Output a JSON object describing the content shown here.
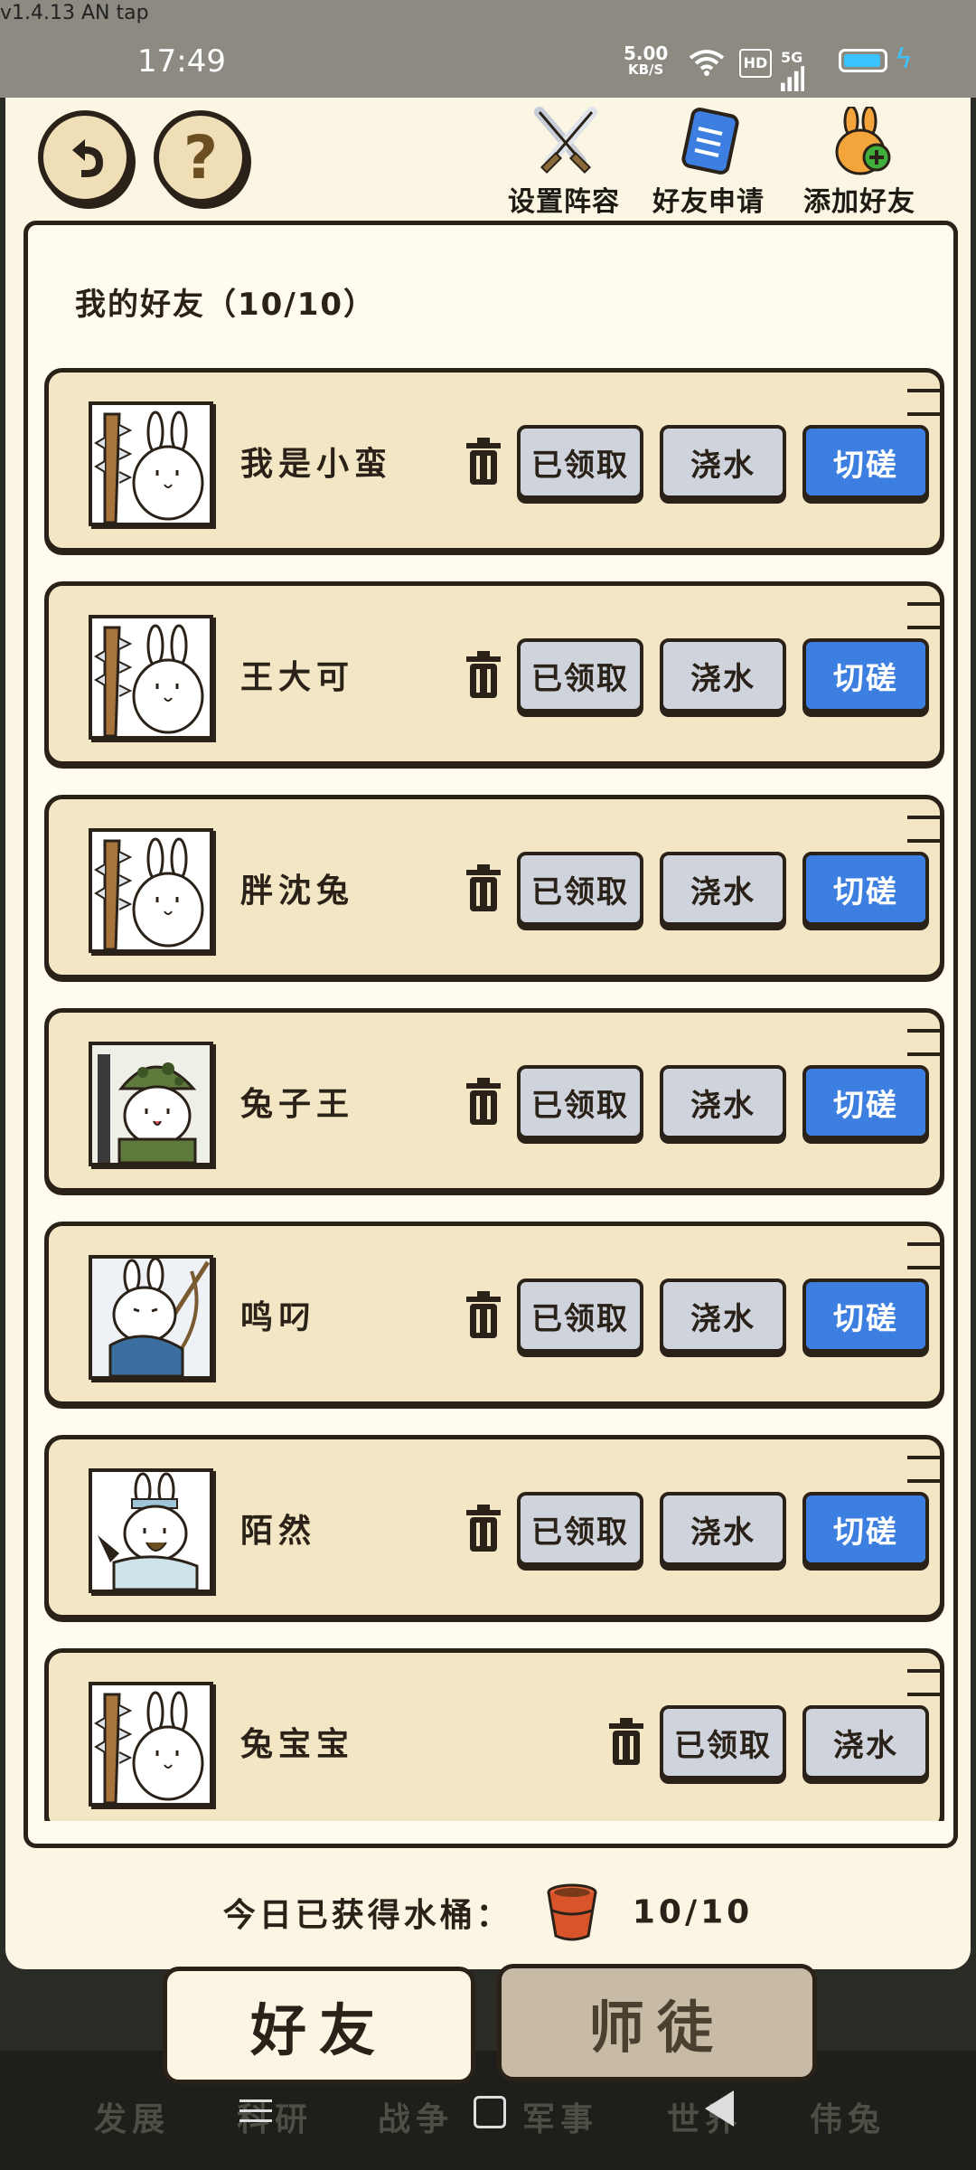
{
  "status_bar": {
    "debug_text": "v1.4.13 AN tap",
    "time": "17:49",
    "net_speed_value": "5.00",
    "net_speed_unit": "KB/S",
    "hd_label": "HD",
    "signal_label": "5G",
    "battery_color": "#3bc3ff"
  },
  "header": {
    "back_icon": "undo-arrow-icon",
    "help_label": "?",
    "actions": [
      {
        "label": "设置阵容",
        "icon": "crossed-swords-icon"
      },
      {
        "label": "好友申请",
        "icon": "request-list-icon"
      },
      {
        "label": "添加好友",
        "icon": "rabbit-add-icon"
      }
    ]
  },
  "friends": {
    "title": "我的好友（10/10）",
    "claimed_label": "已领取",
    "water_label": "浇水",
    "spar_label": "切磋",
    "list": [
      {
        "name": "我是小蛮",
        "avatar": "club-rabbit",
        "can_spar": true
      },
      {
        "name": "王大可",
        "avatar": "club-rabbit",
        "can_spar": true
      },
      {
        "name": "胖沈兔",
        "avatar": "club-rabbit",
        "can_spar": true
      },
      {
        "name": "兔子王",
        "avatar": "soldier-rabbit",
        "can_spar": true
      },
      {
        "name": "鸣叼",
        "avatar": "archer-rabbit",
        "can_spar": true
      },
      {
        "name": "陌然",
        "avatar": "scholar-rabbit",
        "can_spar": true
      },
      {
        "name": "兔宝宝",
        "avatar": "club-rabbit",
        "can_spar": false
      }
    ]
  },
  "water_status": {
    "label": "今日已获得水桶：",
    "value": "10/10"
  },
  "tabs": {
    "friends": "好友",
    "mentor": "师徒"
  },
  "bottom_nav": [
    "发展",
    "科研",
    "战争",
    "军事",
    "世界",
    "伟兔"
  ],
  "colors": {
    "panel_bg": "#fbf6e3",
    "row_bg": "#f3e6c4",
    "button_gray": "#cfd3dc",
    "button_blue": "#3d7fe0",
    "outline": "#2a2118"
  }
}
